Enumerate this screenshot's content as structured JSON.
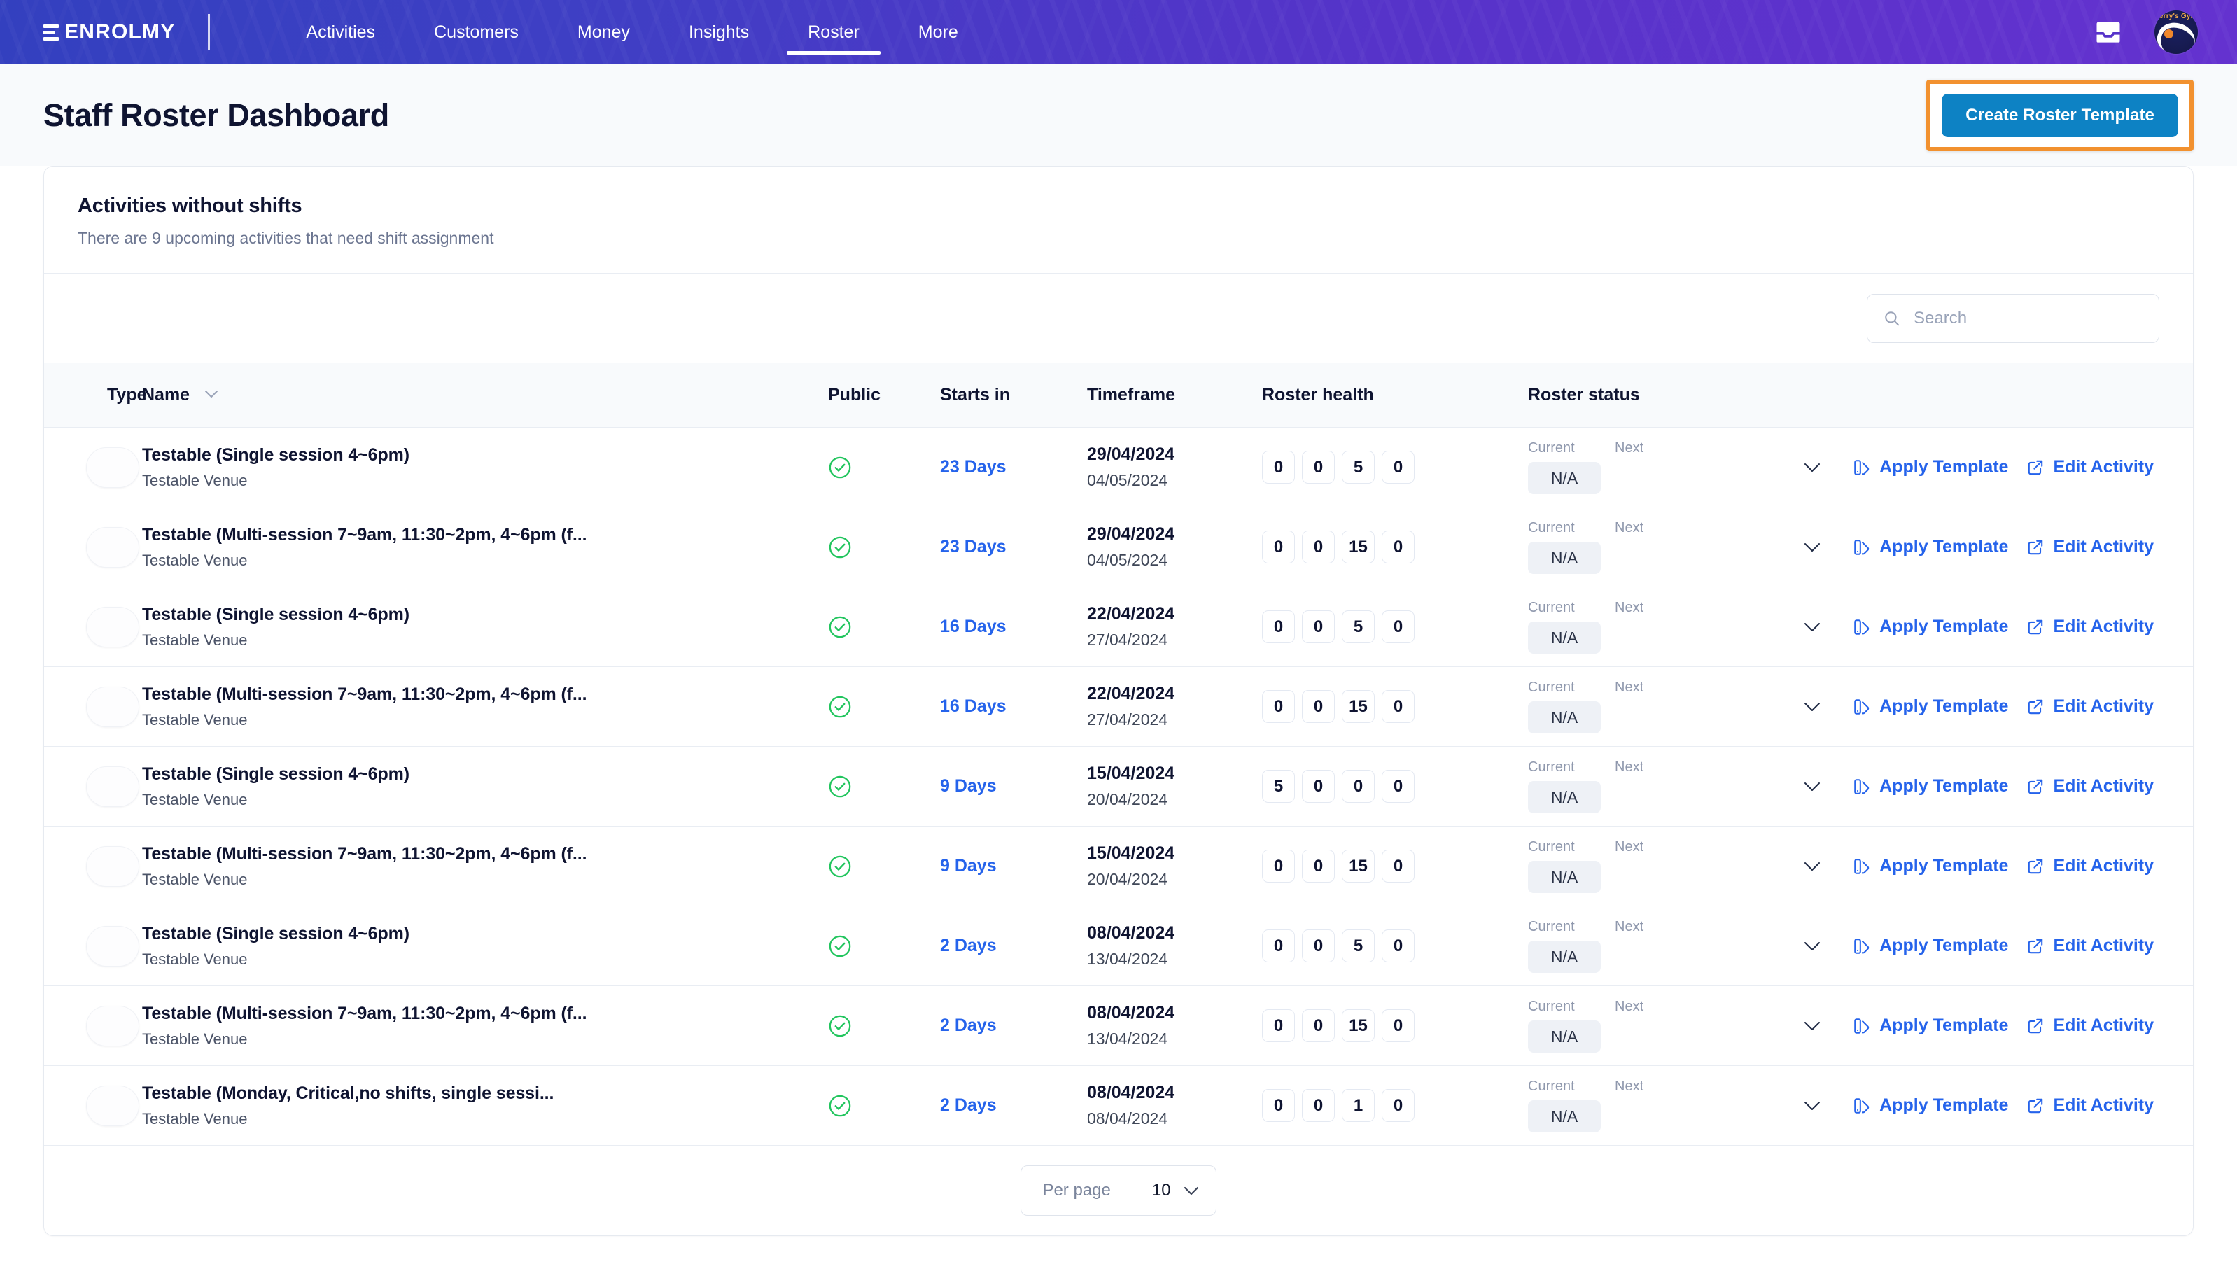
{
  "nav": {
    "brand": "ENROLMY",
    "items": [
      {
        "label": "Activities",
        "active": false
      },
      {
        "label": "Customers",
        "active": false
      },
      {
        "label": "Money",
        "active": false
      },
      {
        "label": "Insights",
        "active": false
      },
      {
        "label": "Roster",
        "active": true
      },
      {
        "label": "More",
        "active": false
      }
    ],
    "inbox_icon": "inbox-icon",
    "avatar_icon": "user-avatar",
    "avatar_text": "Terry's Gym"
  },
  "header": {
    "title": "Staff Roster Dashboard",
    "create_button": "Create Roster Template",
    "highlight_color": "#f2912f",
    "button_color": "#0d82c4"
  },
  "card": {
    "title": "Activities without shifts",
    "subtitle": "There are 9 upcoming activities that need shift assignment"
  },
  "search": {
    "placeholder": "Search",
    "value": "",
    "icon": "search-icon"
  },
  "table": {
    "columns": {
      "type": "Type",
      "name": "Name",
      "public": "Public",
      "starts_in": "Starts in",
      "timeframe": "Timeframe",
      "roster_health": "Roster health",
      "roster_status": "Roster status"
    },
    "status_labels": {
      "current": "Current",
      "next": "Next"
    },
    "actions": {
      "apply": "Apply Template",
      "edit": "Edit Activity"
    },
    "rows": [
      {
        "name": "Testable (Single session 4~6pm)",
        "venue": "Testable Venue",
        "public": true,
        "starts_in": "23 Days",
        "start_date": "29/04/2024",
        "end_date": "04/05/2024",
        "health": [
          "0",
          "0",
          "5",
          "0"
        ],
        "status_current": "N/A"
      },
      {
        "name": "Testable (Multi-session 7~9am, 11:30~2pm, 4~6pm (f...",
        "venue": "Testable Venue",
        "public": true,
        "starts_in": "23 Days",
        "start_date": "29/04/2024",
        "end_date": "04/05/2024",
        "health": [
          "0",
          "0",
          "15",
          "0"
        ],
        "status_current": "N/A"
      },
      {
        "name": "Testable (Single session 4~6pm)",
        "venue": "Testable Venue",
        "public": true,
        "starts_in": "16 Days",
        "start_date": "22/04/2024",
        "end_date": "27/04/2024",
        "health": [
          "0",
          "0",
          "5",
          "0"
        ],
        "status_current": "N/A"
      },
      {
        "name": "Testable (Multi-session 7~9am, 11:30~2pm, 4~6pm (f...",
        "venue": "Testable Venue",
        "public": true,
        "starts_in": "16 Days",
        "start_date": "22/04/2024",
        "end_date": "27/04/2024",
        "health": [
          "0",
          "0",
          "15",
          "0"
        ],
        "status_current": "N/A"
      },
      {
        "name": "Testable (Single session 4~6pm)",
        "venue": "Testable Venue",
        "public": true,
        "starts_in": "9 Days",
        "start_date": "15/04/2024",
        "end_date": "20/04/2024",
        "health": [
          "5",
          "0",
          "0",
          "0"
        ],
        "status_current": "N/A"
      },
      {
        "name": "Testable (Multi-session 7~9am, 11:30~2pm, 4~6pm (f...",
        "venue": "Testable Venue",
        "public": true,
        "starts_in": "9 Days",
        "start_date": "15/04/2024",
        "end_date": "20/04/2024",
        "health": [
          "0",
          "0",
          "15",
          "0"
        ],
        "status_current": "N/A"
      },
      {
        "name": "Testable (Single session 4~6pm)",
        "venue": "Testable Venue",
        "public": true,
        "starts_in": "2 Days",
        "start_date": "08/04/2024",
        "end_date": "13/04/2024",
        "health": [
          "0",
          "0",
          "5",
          "0"
        ],
        "status_current": "N/A"
      },
      {
        "name": "Testable (Multi-session 7~9am, 11:30~2pm, 4~6pm (f...",
        "venue": "Testable Venue",
        "public": true,
        "starts_in": "2 Days",
        "start_date": "08/04/2024",
        "end_date": "13/04/2024",
        "health": [
          "0",
          "0",
          "15",
          "0"
        ],
        "status_current": "N/A"
      },
      {
        "name": "Testable (Monday, Critical,no shifts, single sessi...",
        "venue": "Testable Venue",
        "public": true,
        "starts_in": "2 Days",
        "start_date": "08/04/2024",
        "end_date": "08/04/2024",
        "health": [
          "0",
          "0",
          "1",
          "0"
        ],
        "status_current": "N/A"
      }
    ]
  },
  "pagination": {
    "per_page_label": "Per page",
    "per_page_value": "10"
  }
}
